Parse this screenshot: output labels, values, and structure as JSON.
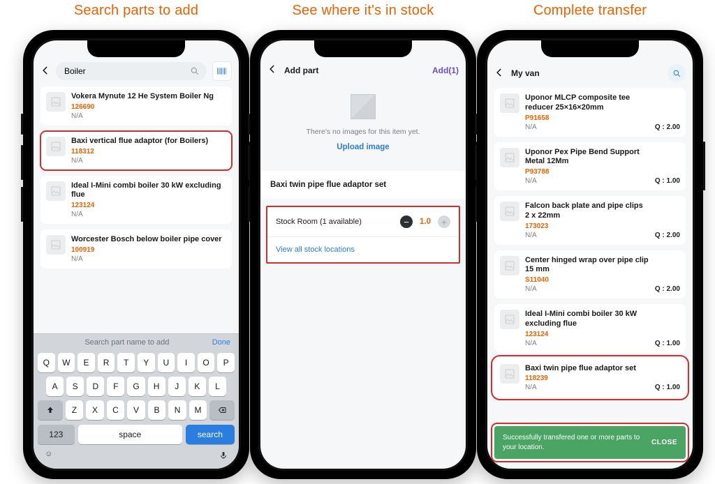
{
  "captions": {
    "c1": "Search parts to add",
    "c2": "See where it's in stock",
    "c3": "Complete transfer"
  },
  "screen1": {
    "search_value": "Boiler",
    "items": [
      {
        "name": "Vokera Mynute 12 He System Boiler Ng",
        "sku": "126690",
        "na": "N/A"
      },
      {
        "name": "Baxi vertical flue adaptor (for Boilers)",
        "sku": "118312",
        "na": "N/A"
      },
      {
        "name": "Ideal I-Mini combi boiler 30 kW excluding flue",
        "sku": "123124",
        "na": "N/A"
      },
      {
        "name": "Worcester Bosch below boiler pipe cover",
        "sku": "100919",
        "na": "N/A"
      }
    ],
    "kb_hint": "Search part name to add",
    "kb_done": "Done",
    "kb_rows": {
      "r1": [
        "Q",
        "W",
        "E",
        "R",
        "T",
        "Y",
        "U",
        "I",
        "O",
        "P"
      ],
      "r2": [
        "A",
        "S",
        "D",
        "F",
        "G",
        "H",
        "J",
        "K",
        "L"
      ],
      "r3": [
        "Z",
        "X",
        "C",
        "V",
        "B",
        "N",
        "M"
      ]
    },
    "k123": "123",
    "kspace": "space",
    "ksearch": "search"
  },
  "screen2": {
    "title": "Add part",
    "add_label": "Add(1)",
    "noimg": "There's no images for this item yet.",
    "upload": "Upload image",
    "part_name": "Baxi twin pipe flue adaptor set",
    "stock_label": "Stock Room (1 available)",
    "qty": "1.0",
    "view_all": "View all stock locations"
  },
  "screen3": {
    "title": "My van",
    "q_prefix": "Q : ",
    "items": [
      {
        "name": "Uponor MLCP composite tee reducer 25×16×20mm",
        "sku": "P91658",
        "na": "N/A",
        "q": "2.00"
      },
      {
        "name": "Uponor Pex Pipe Bend Support Metal 12Mm",
        "sku": "P93788",
        "na": "N/A",
        "q": "1.00"
      },
      {
        "name": "Falcon back plate and pipe clips 2 x 22mm",
        "sku": "173023",
        "na": "N/A",
        "q": "2.00"
      },
      {
        "name": "Center hinged wrap over pipe clip 15 mm",
        "sku": "S11040",
        "na": "N/A",
        "q": "2.00"
      },
      {
        "name": "Ideal I-Mini combi boiler 30 kW excluding flue",
        "sku": "123124",
        "na": "N/A",
        "q": "1.00"
      },
      {
        "name": "Baxi twin pipe flue adaptor set",
        "sku": "118239",
        "na": "N/A",
        "q": "1.00"
      }
    ],
    "toast_msg": "Successfully transfered one or more parts to your location.",
    "toast_close": "CLOSE"
  }
}
